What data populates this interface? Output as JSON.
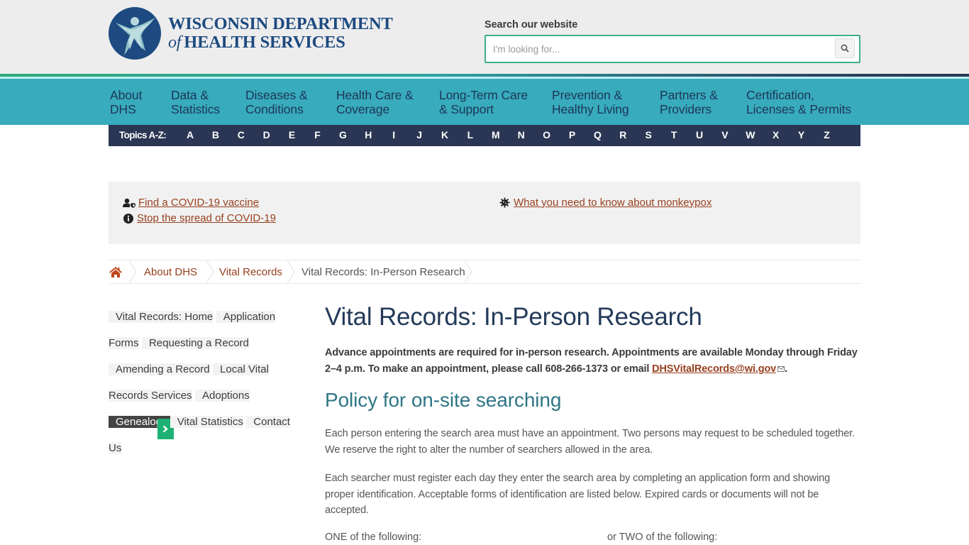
{
  "header": {
    "logo": {
      "line1": "WISCONSIN DEPARTMENT",
      "line2_of": "of",
      "line2_rest": "HEALTH SERVICES",
      "brand_color": "#1d4a80"
    },
    "search": {
      "label": "Search our website",
      "placeholder": "I'm looking for...",
      "value": "",
      "button_icon": "search-icon"
    }
  },
  "main_nav": {
    "items": [
      {
        "label": "About\nDHS"
      },
      {
        "label": "Data &\nStatistics"
      },
      {
        "label": "Diseases &\nConditions"
      },
      {
        "label": "Health Care &\nCoverage"
      },
      {
        "label": "Long-Term Care\n& Support"
      },
      {
        "label": "Prevention &\nHealthy Living"
      },
      {
        "label": "Partners &\nProviders"
      },
      {
        "label": "Certification,\nLicenses & Permits"
      }
    ]
  },
  "topics_az": {
    "label": "Topics A-Z:",
    "letters": [
      "A",
      "B",
      "C",
      "D",
      "E",
      "F",
      "G",
      "H",
      "I",
      "J",
      "K",
      "L",
      "M",
      "N",
      "O",
      "P",
      "Q",
      "R",
      "S",
      "T",
      "U",
      "V",
      "W",
      "X",
      "Y",
      "Z"
    ]
  },
  "alerts": [
    {
      "icon": "user-shield-icon",
      "text": "Find a COVID-19 vaccine"
    },
    {
      "icon": "info-circle-icon",
      "text": "Stop the spread of COVID-19"
    },
    {
      "icon": "virus-icon",
      "text": "What you need to know about monkeypox"
    }
  ],
  "breadcrumb": {
    "home_icon": "home-icon",
    "items": [
      {
        "label": "About DHS",
        "link": true
      },
      {
        "label": "Vital Records",
        "link": true
      },
      {
        "label": "Vital Records: In-Person Research",
        "link": false
      }
    ]
  },
  "sidebar": {
    "items": [
      {
        "label": "Vital Records: Home",
        "active": false
      },
      {
        "label": "Application Forms",
        "active": false
      },
      {
        "label": "Requesting a Record",
        "active": false
      },
      {
        "label": "Amending a Record",
        "active": false
      },
      {
        "label": "Local Vital Records Services",
        "active": false
      },
      {
        "label": "Adoptions",
        "active": false
      },
      {
        "label": "Genealogy",
        "active": true
      },
      {
        "label": "Vital Statistics",
        "active": false
      },
      {
        "label": "Contact Us",
        "active": false
      }
    ]
  },
  "content": {
    "title": "Vital Records: In-Person Research",
    "intro_text": "Advance appointments are required for in-person research. Appointments are available Monday through Friday 2–4 p.m. To make an appointment, please call 608-266-1373 or email ",
    "intro_email": "DHSVitalRecords@wi.gov",
    "intro_end": ".",
    "section_heading": "Policy for on-site searching",
    "paragraphs": [
      "Each person entering the search area must have an appointment. Two persons may request to be scheduled together. We reserve the right to alter the number of searchers allowed in the area.",
      "Each searcher must register each day they enter the search area by completing an application form and showing proper identification. Acceptable forms of identification are listed below. Expired cards or documents will not be accepted."
    ],
    "id_columns": {
      "col1": "ONE of the following:",
      "col2": "or TWO of the following:"
    }
  },
  "colors": {
    "nav_bg": "#38abbd",
    "az_bg": "#2a3653",
    "link": "#98401f",
    "active_nav": "#444444",
    "active_arrow": "#1db173",
    "search_border": "#3fae8c"
  }
}
